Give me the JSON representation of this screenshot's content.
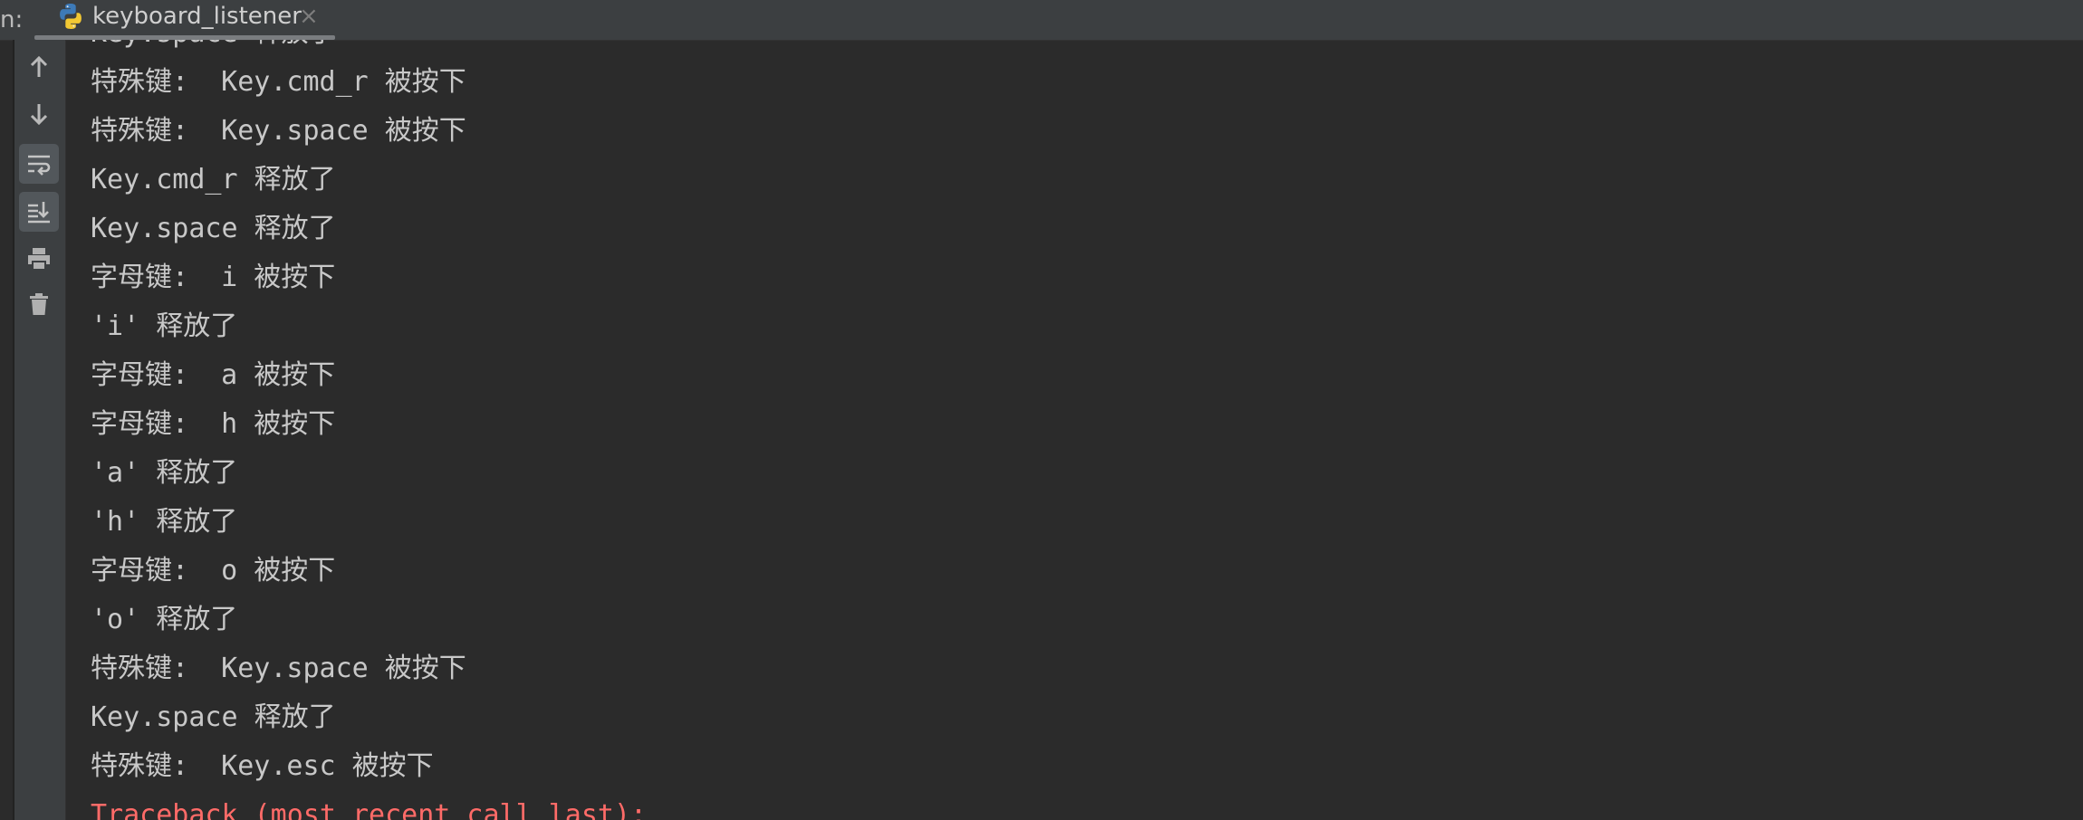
{
  "topbar": {
    "run_label": "n:",
    "tab_title": "keyboard_listener",
    "tab_close": "×",
    "tab_icon": "python-icon"
  },
  "toolbar": {
    "icons": [
      "arrow-up-icon",
      "arrow-down-icon",
      "soft-wrap-icon",
      "scroll-to-end-icon",
      "print-icon",
      "trash-icon"
    ]
  },
  "console": {
    "lines": [
      "Key.space 释放了",
      "特殊键:  Key.cmd_r 被按下",
      "特殊键:  Key.space 被按下",
      "Key.cmd_r 释放了",
      "Key.space 释放了",
      "字母键:  i 被按下",
      "'i' 释放了",
      "字母键:  a 被按下",
      "字母键:  h 被按下",
      "'a' 释放了",
      "'h' 释放了",
      "字母键:  o 被按下",
      "'o' 释放了",
      "特殊键:  Key.space 被按下",
      "Key.space 释放了",
      "特殊键:  Key.esc 被按下",
      "Traceback (most recent call last):"
    ]
  },
  "colors": {
    "background": "#2b2b2b",
    "panel": "#3c3f41",
    "text": "#c8c8c8",
    "error": "#ff6b68"
  }
}
